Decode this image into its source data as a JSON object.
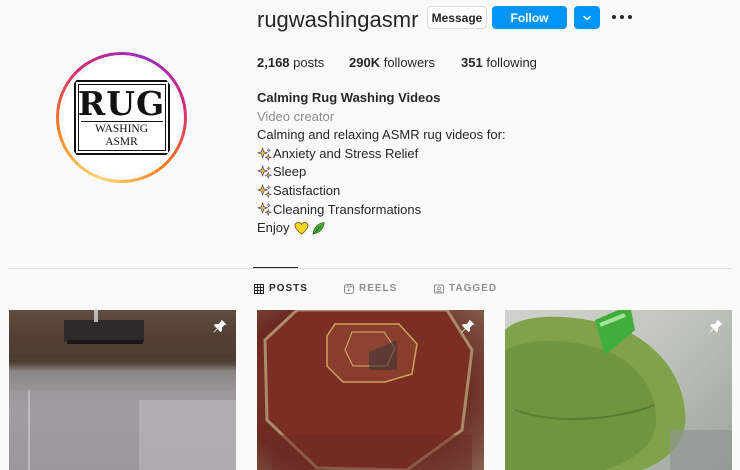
{
  "profile": {
    "username": "rugwashingasmr",
    "avatar_text_big": "RUG",
    "avatar_text_small": "WASHING ASMR"
  },
  "actions": {
    "message_label": "Message",
    "follow_label": "Follow"
  },
  "stats": {
    "posts_count": "2,168",
    "posts_label": "posts",
    "followers_count": "290K",
    "followers_label": "followers",
    "following_count": "351",
    "following_label": "following"
  },
  "bio": {
    "name": "Calming Rug Washing Videos",
    "category": "Video creator",
    "intro": "Calming and relaxing ASMR rug videos for:",
    "items": [
      "Anxiety and Stress Relief",
      "Sleep",
      "Satisfaction",
      "Cleaning Transformations"
    ],
    "closing": "Enjoy"
  },
  "tabs": {
    "posts": "POSTS",
    "reels": "REELS",
    "tagged": "TAGGED"
  },
  "colors": {
    "primary_blue": "#0095f6",
    "text": "#262626",
    "muted": "#8e8e8e",
    "background": "#fafafa"
  },
  "icons": {
    "more": "more-horizontal-icon",
    "dropdown": "chevron-down-icon",
    "posts_tab": "grid-icon",
    "reels_tab": "reels-icon",
    "tagged_tab": "tagged-icon",
    "pinned": "pin-icon",
    "bullet": "sparkle-icon"
  }
}
